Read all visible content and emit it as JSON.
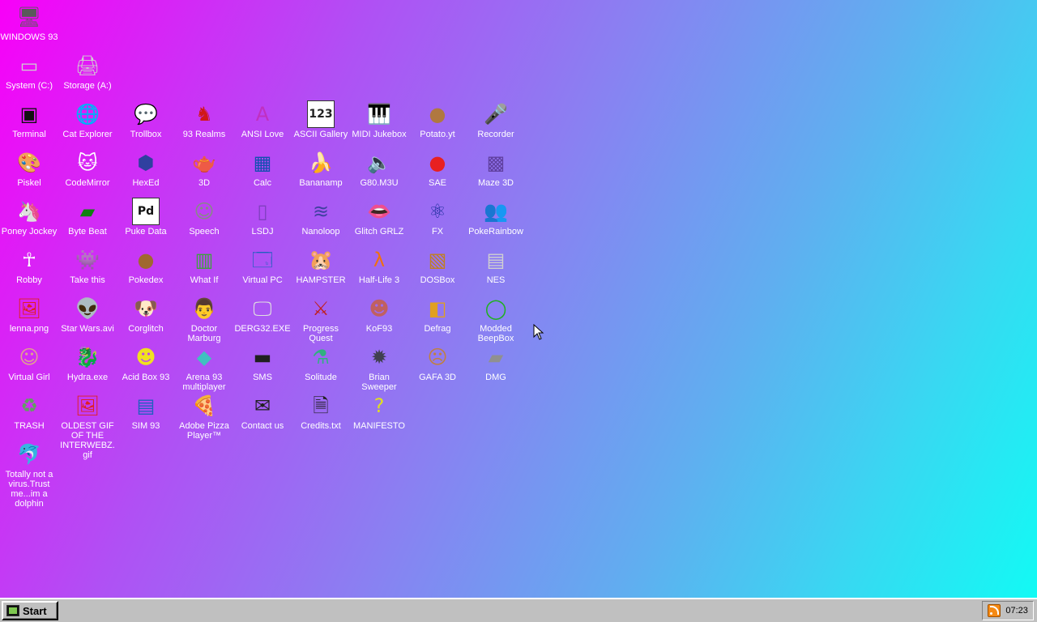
{
  "desktop": {
    "icons": [
      {
        "label": "WINDOWS 93",
        "icon": "computer-icon",
        "glyph": "🖥",
        "color": "#5a5a5a"
      },
      {
        "label": "System (C:)",
        "icon": "hard-drive-icon",
        "glyph": "▭",
        "color": "#d0d0d0"
      },
      {
        "label": "Storage (A:)",
        "icon": "floppy-drive-icon",
        "glyph": "🖨",
        "color": "#d0d0d0"
      },
      {
        "label": "Terminal",
        "icon": "terminal-icon",
        "glyph": "▣",
        "color": "#111111"
      },
      {
        "label": "Cat Explorer",
        "icon": "globe-cat-icon",
        "glyph": "🌐",
        "color": "#2a7ad8"
      },
      {
        "label": "Trollbox",
        "icon": "chat-bubble-icon",
        "glyph": "💬",
        "color": "#3ab0e8"
      },
      {
        "label": "93 Realms",
        "icon": "knight-icon",
        "glyph": "♞",
        "color": "#d01818"
      },
      {
        "label": "ANSI Love",
        "icon": "letter-a-icon",
        "glyph": "A",
        "color": "#c030c0"
      },
      {
        "label": "ASCII Gallery",
        "icon": "numbers-icon",
        "glyph": "123",
        "color": "#222222"
      },
      {
        "label": "MIDI Jukebox",
        "icon": "piano-icon",
        "glyph": "🎹",
        "color": "#222222"
      },
      {
        "label": "Potato.yt",
        "icon": "potato-icon",
        "glyph": "●",
        "color": "#b07840"
      },
      {
        "label": "Recorder",
        "icon": "microphone-icon",
        "glyph": "🎤",
        "color": "#666666"
      },
      {
        "label": "Piskel",
        "icon": "palette-icon",
        "glyph": "🎨",
        "color": "#e8c060"
      },
      {
        "label": "CodeMirror",
        "icon": "cat-face-icon",
        "glyph": "🐱",
        "color": "#ffffff"
      },
      {
        "label": "HexEd",
        "icon": "hexagon-icon",
        "glyph": "⬢",
        "color": "#3040a0"
      },
      {
        "label": "3D",
        "icon": "teapot-icon",
        "glyph": "🫖",
        "color": "#f0a0c0"
      },
      {
        "label": "Calc",
        "icon": "calculator-icon",
        "glyph": "▦",
        "color": "#1050b0"
      },
      {
        "label": "Bananamp",
        "icon": "banana-icon",
        "glyph": "🍌",
        "color": "#f0d020"
      },
      {
        "label": "G80.M3U",
        "icon": "speaker-file-icon",
        "glyph": "🔈",
        "color": "#8030a0"
      },
      {
        "label": "SAE",
        "icon": "checkered-ball-icon",
        "glyph": "●",
        "color": "#e82020"
      },
      {
        "label": "Maze 3D",
        "icon": "maze-icon",
        "glyph": "▩",
        "color": "#6040a0"
      },
      {
        "label": "Poney Jockey",
        "icon": "pony-icon",
        "glyph": "🦄",
        "color": "#c080e0"
      },
      {
        "label": "Byte Beat",
        "icon": "waveform-icon",
        "glyph": "▰",
        "color": "#108010"
      },
      {
        "label": "Puke Data",
        "icon": "pd-patch-icon",
        "glyph": "Pd",
        "color": "#111111"
      },
      {
        "label": "Speech",
        "icon": "face-panel-icon",
        "glyph": "☺",
        "color": "#888888"
      },
      {
        "label": "LSDJ",
        "icon": "gameboy-icon",
        "glyph": "▯",
        "color": "#8040c0"
      },
      {
        "label": "Nanoloop",
        "icon": "wave-lines-icon",
        "glyph": "≋",
        "color": "#4040a0"
      },
      {
        "label": "Glitch GRLZ",
        "icon": "lips-icon",
        "glyph": "👄",
        "color": "#e02040"
      },
      {
        "label": "FX",
        "icon": "atom-icon",
        "glyph": "⚛",
        "color": "#2030a0"
      },
      {
        "label": "PokeRainbow",
        "icon": "trainers-icon",
        "glyph": "👥",
        "color": "#505050"
      },
      {
        "label": "Robby",
        "icon": "stick-figure-icon",
        "glyph": "☥",
        "color": "#ffffff"
      },
      {
        "label": "Take this",
        "icon": "pixel-character-icon",
        "glyph": "👾",
        "color": "#f06020"
      },
      {
        "label": "Pokedex",
        "icon": "cookie-creature-icon",
        "glyph": "●",
        "color": "#a06830"
      },
      {
        "label": "What If",
        "icon": "green-grid-icon",
        "glyph": "▥",
        "color": "#40a040"
      },
      {
        "label": "Virtual PC",
        "icon": "window-cursor-icon",
        "glyph": "🗔",
        "color": "#2060c0"
      },
      {
        "label": "HAMPSTER",
        "icon": "hamster-icon",
        "glyph": "🐹",
        "color": "#e0c0a0"
      },
      {
        "label": "Half-Life 3",
        "icon": "lambda-icon",
        "glyph": "λ",
        "color": "#f07010"
      },
      {
        "label": "DOSBox",
        "icon": "dosbox-icon",
        "glyph": "▧",
        "color": "#c08020"
      },
      {
        "label": "NES",
        "icon": "nes-console-icon",
        "glyph": "▤",
        "color": "#d0d0d0"
      },
      {
        "label": "lenna.png",
        "icon": "image-file-icon",
        "glyph": "🖼",
        "color": "#e02020"
      },
      {
        "label": "Star Wars.avi",
        "icon": "yoda-icon",
        "glyph": "👽",
        "color": "#60a030"
      },
      {
        "label": "Corglitch",
        "icon": "corgi-icon",
        "glyph": "🐶",
        "color": "#e08030"
      },
      {
        "label": "Doctor Marburg",
        "icon": "doctor-icon",
        "glyph": "👨",
        "color": "#e04040"
      },
      {
        "label": "DERG32.EXE",
        "icon": "monitor-face-icon",
        "glyph": "🖵",
        "color": "#e0e0e0"
      },
      {
        "label": "Progress Quest",
        "icon": "crossed-swords-icon",
        "glyph": "⚔",
        "color": "#c02020"
      },
      {
        "label": "KoF93",
        "icon": "fighter-portrait-icon",
        "glyph": "☻",
        "color": "#c06060"
      },
      {
        "label": "Defrag",
        "icon": "defrag-icon",
        "glyph": "◧",
        "color": "#e0a020"
      },
      {
        "label": "Modded BeepBox",
        "icon": "green-ring-icon",
        "glyph": "◯",
        "color": "#20b020"
      },
      {
        "label": "Virtual Girl",
        "icon": "face-portrait-icon",
        "glyph": "☺",
        "color": "#e0a090"
      },
      {
        "label": "Hydra.exe",
        "icon": "hydra-icon",
        "glyph": "🐉",
        "color": "#30a040"
      },
      {
        "label": "Acid Box 93",
        "icon": "smiley-icon",
        "glyph": "☻",
        "color": "#f0e020"
      },
      {
        "label": "Arena 93 multiplayer",
        "icon": "cube-icon",
        "glyph": "◆",
        "color": "#40c0c0"
      },
      {
        "label": "SMS",
        "icon": "sega-console-icon",
        "glyph": "▬",
        "color": "#202020"
      },
      {
        "label": "Solitude",
        "icon": "potion-bottle-icon",
        "glyph": "⚗",
        "color": "#30b080"
      },
      {
        "label": "Brian Sweeper",
        "icon": "mine-icon",
        "glyph": "✹",
        "color": "#404050"
      },
      {
        "label": "GAFA 3D",
        "icon": "doom-face-icon",
        "glyph": "☹",
        "color": "#c08040"
      },
      {
        "label": "DMG",
        "icon": "disk-image-icon",
        "glyph": "▰",
        "color": "#909090"
      },
      {
        "label": "TRASH",
        "icon": "recycle-bin-icon",
        "glyph": "♻",
        "color": "#60a060"
      },
      {
        "label": "OLDEST GIF OF THE INTERWEBZ.gif",
        "icon": "gif-file-icon",
        "glyph": "🖼",
        "color": "#e02020"
      },
      {
        "label": "SIM 93",
        "icon": "id-card-icon",
        "glyph": "▤",
        "color": "#2060c0"
      },
      {
        "label": "Adobe Pizza Player™",
        "icon": "pizza-icon",
        "glyph": "🍕",
        "color": "#e0a040"
      },
      {
        "label": "Contact us",
        "icon": "write-letter-icon",
        "glyph": "✉",
        "color": "#202020"
      },
      {
        "label": "Credits.txt",
        "icon": "text-file-icon",
        "glyph": "🗎",
        "color": "#202020"
      },
      {
        "label": "MANIFESTO",
        "icon": "question-mark-icon",
        "glyph": "?",
        "color": "#e0e020"
      },
      {
        "label": "Totally not a virus.Trust me...im a dolphin",
        "icon": "dolphin-shortcut-icon",
        "glyph": "🐬",
        "color": "#3080c0"
      }
    ]
  },
  "taskbar": {
    "start_label": "Start",
    "clock": "07:23",
    "tray_icon": "rss-icon"
  }
}
